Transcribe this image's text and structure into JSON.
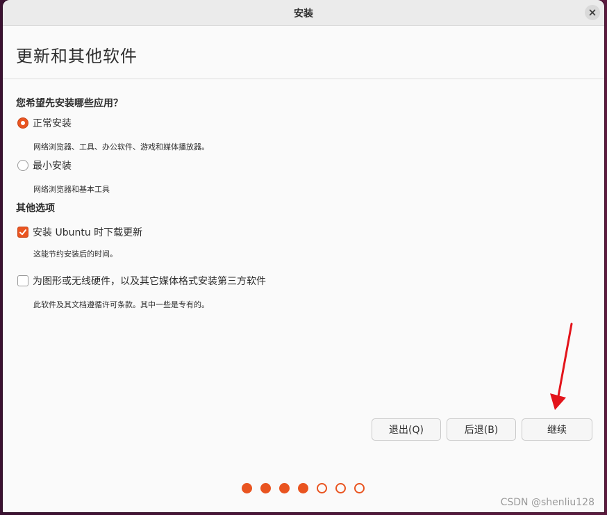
{
  "window": {
    "title": "安装",
    "close_icon": "close-icon"
  },
  "page": {
    "title": "更新和其他软件"
  },
  "apps_section": {
    "heading": "您希望先安装哪些应用？",
    "options": [
      {
        "label": "正常安装",
        "description": "网络浏览器、工具、办公软件、游戏和媒体播放器。",
        "selected": true
      },
      {
        "label": "最小安装",
        "description": "网络浏览器和基本工具",
        "selected": false
      }
    ]
  },
  "other_section": {
    "heading": "其他选项",
    "options": [
      {
        "label": "安装 Ubuntu 时下载更新",
        "description": "这能节约安装后的时间。",
        "checked": true
      },
      {
        "label": "为图形或无线硬件，以及其它媒体格式安装第三方软件",
        "description": "此软件及其文档遵循许可条款。其中一些是专有的。",
        "checked": false
      }
    ]
  },
  "buttons": {
    "quit": "退出(Q)",
    "back": "后退(B)",
    "continue": "继续"
  },
  "progress": {
    "total_steps": 7,
    "completed_steps": 4
  },
  "watermark": "CSDN @shenliu128",
  "colors": {
    "accent": "#e95420",
    "annotation_arrow": "#e3141b"
  }
}
